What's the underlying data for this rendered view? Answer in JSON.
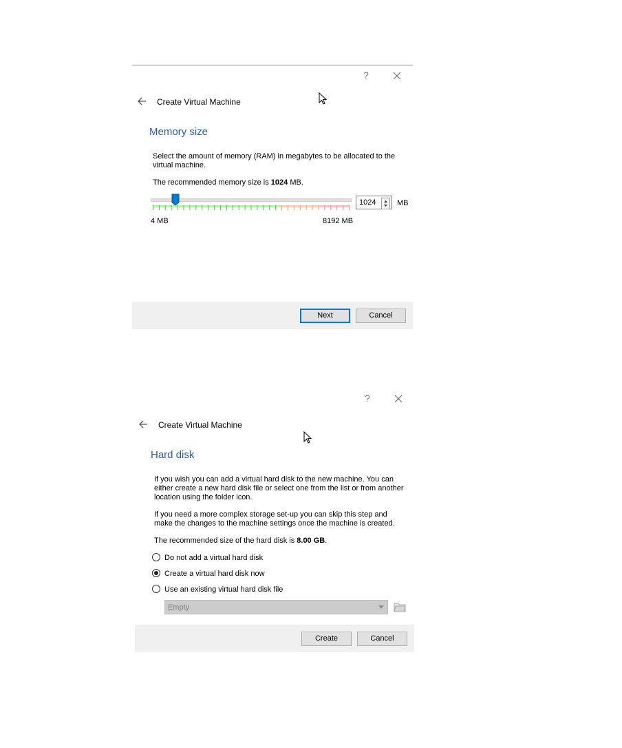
{
  "dialog1": {
    "help": "?",
    "title": "Create Virtual Machine",
    "heading": "Memory size",
    "desc": "Select the amount of memory (RAM) in megabytes to be allocated to the virtual machine.",
    "rec_prefix": "The recommended memory size is ",
    "rec_value": "1024",
    "rec_suffix": " MB.",
    "slider_min": "4 MB",
    "slider_max": "8192 MB",
    "slider_value_fraction": 0.125,
    "spin_value": "1024",
    "unit": "MB",
    "next_label": "Next",
    "cancel_label": "Cancel"
  },
  "dialog2": {
    "help": "?",
    "title": "Create Virtual Machine",
    "heading": "Hard disk",
    "desc1": "If you wish you can add a virtual hard disk to the new machine. You can either create a new hard disk file or select one from the list or from another location using the folder icon.",
    "desc2": "If you need a more complex storage set-up you can skip this step and make the changes to the machine settings once the machine is created.",
    "rec_prefix": "The recommended size of the hard disk is ",
    "rec_value": "8.00 GB",
    "rec_suffix": ".",
    "options": [
      {
        "label": "Do not add a virtual hard disk",
        "checked": false
      },
      {
        "label": "Create a virtual hard disk now",
        "checked": true
      },
      {
        "label": "Use an existing virtual hard disk file",
        "checked": false
      }
    ],
    "combo_value": "Empty",
    "create_label": "Create",
    "cancel_label": "Cancel"
  },
  "colors": {
    "heading": "#2b5ea7",
    "accent": "#0078d7",
    "footer": "#f0f0f0"
  }
}
